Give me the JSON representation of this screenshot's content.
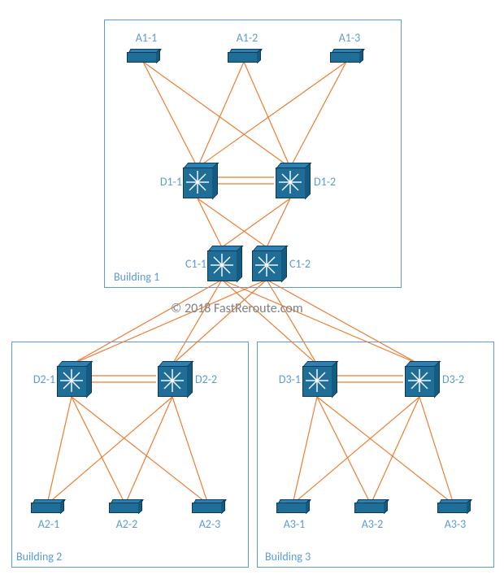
{
  "diagram": {
    "copyright": "© 2018 FastReroute.com",
    "buildings": [
      {
        "id": "b1",
        "label": "Building 1"
      },
      {
        "id": "b2",
        "label": "Building 2"
      },
      {
        "id": "b3",
        "label": "Building 3"
      }
    ],
    "devices": {
      "A1_1": {
        "label": "A1-1",
        "type": "access-switch"
      },
      "A1_2": {
        "label": "A1-2",
        "type": "access-switch"
      },
      "A1_3": {
        "label": "A1-3",
        "type": "access-switch"
      },
      "D1_1": {
        "label": "D1-1",
        "type": "l3-switch"
      },
      "D1_2": {
        "label": "D1-2",
        "type": "l3-switch"
      },
      "C1_1": {
        "label": "C1-1",
        "type": "l3-switch"
      },
      "C1_2": {
        "label": "C1-2",
        "type": "l3-switch"
      },
      "D2_1": {
        "label": "D2-1",
        "type": "l3-switch"
      },
      "D2_2": {
        "label": "D2-2",
        "type": "l3-switch"
      },
      "A2_1": {
        "label": "A2-1",
        "type": "access-switch"
      },
      "A2_2": {
        "label": "A2-2",
        "type": "access-switch"
      },
      "A2_3": {
        "label": "A2-3",
        "type": "access-switch"
      },
      "D3_1": {
        "label": "D3-1",
        "type": "l3-switch"
      },
      "D3_2": {
        "label": "D3-2",
        "type": "l3-switch"
      },
      "A3_1": {
        "label": "A3-1",
        "type": "access-switch"
      },
      "A3_2": {
        "label": "A3-2",
        "type": "access-switch"
      },
      "A3_3": {
        "label": "A3-3",
        "type": "access-switch"
      }
    },
    "links": [
      [
        "A1_1",
        "D1_1"
      ],
      [
        "A1_1",
        "D1_2"
      ],
      [
        "A1_2",
        "D1_1"
      ],
      [
        "A1_2",
        "D1_2"
      ],
      [
        "A1_3",
        "D1_1"
      ],
      [
        "A1_3",
        "D1_2"
      ],
      [
        "D1_1",
        "D1_2",
        "double"
      ],
      [
        "D1_1",
        "C1_1"
      ],
      [
        "D1_1",
        "C1_2"
      ],
      [
        "D1_2",
        "C1_1"
      ],
      [
        "D1_2",
        "C1_2"
      ],
      [
        "C1_1",
        "D2_1"
      ],
      [
        "C1_1",
        "D2_2"
      ],
      [
        "C1_1",
        "D3_1"
      ],
      [
        "C1_1",
        "D3_2"
      ],
      [
        "C1_2",
        "D2_1"
      ],
      [
        "C1_2",
        "D2_2"
      ],
      [
        "C1_2",
        "D3_1"
      ],
      [
        "C1_2",
        "D3_2"
      ],
      [
        "D2_1",
        "D2_2",
        "double"
      ],
      [
        "D2_1",
        "A2_1"
      ],
      [
        "D2_1",
        "A2_2"
      ],
      [
        "D2_1",
        "A2_3"
      ],
      [
        "D2_2",
        "A2_1"
      ],
      [
        "D2_2",
        "A2_2"
      ],
      [
        "D2_2",
        "A2_3"
      ],
      [
        "D3_1",
        "D3_2",
        "double"
      ],
      [
        "D3_1",
        "A3_1"
      ],
      [
        "D3_1",
        "A3_2"
      ],
      [
        "D3_1",
        "A3_3"
      ],
      [
        "D3_2",
        "A3_1"
      ],
      [
        "D3_2",
        "A3_2"
      ],
      [
        "D3_2",
        "A3_3"
      ]
    ],
    "colors": {
      "link": "#ed7d31",
      "box_border": "#5b9bd5",
      "label": "#5b9bd5",
      "device_fill": "#1f6e98",
      "device_light": "#2a82b4",
      "device_dark": "#155a80"
    }
  }
}
